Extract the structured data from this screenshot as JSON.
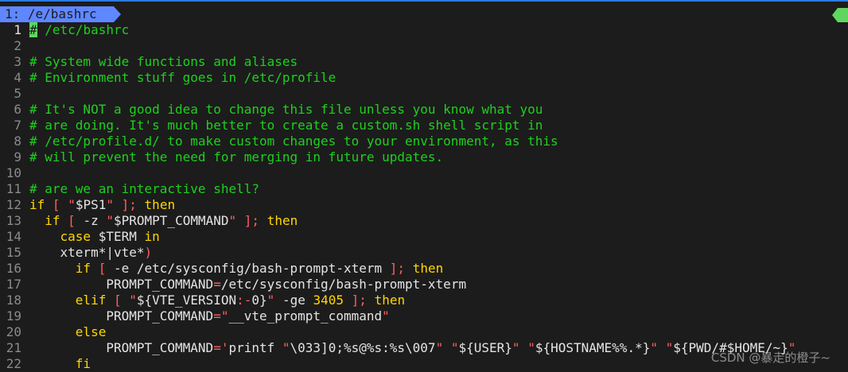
{
  "window": {
    "tab_label": "1: /e/bashrc"
  },
  "editor": {
    "lines": [
      {
        "n": "1",
        "t": "# /etc/bashrc"
      },
      {
        "n": "2",
        "t": ""
      },
      {
        "n": "3",
        "t": "# System wide functions and aliases"
      },
      {
        "n": "4",
        "t": "# Environment stuff goes in /etc/profile"
      },
      {
        "n": "5",
        "t": ""
      },
      {
        "n": "6",
        "t": "# It's NOT a good idea to change this file unless you know what you"
      },
      {
        "n": "7",
        "t": "# are doing. It's much better to create a custom.sh shell script in"
      },
      {
        "n": "8",
        "t": "# /etc/profile.d/ to make custom changes to your environment, as this"
      },
      {
        "n": "9",
        "t": "# will prevent the need for merging in future updates."
      },
      {
        "n": "10",
        "t": ""
      },
      {
        "n": "11",
        "t": "# are we an interactive shell?"
      },
      {
        "n": "12",
        "t": "if [ \"$PS1\" ]; then"
      },
      {
        "n": "13",
        "t": "  if [ -z \"$PROMPT_COMMAND\" ]; then"
      },
      {
        "n": "14",
        "t": "    case $TERM in"
      },
      {
        "n": "15",
        "t": "    xterm*|vte*)"
      },
      {
        "n": "16",
        "t": "      if [ -e /etc/sysconfig/bash-prompt-xterm ]; then"
      },
      {
        "n": "17",
        "t": "          PROMPT_COMMAND=/etc/sysconfig/bash-prompt-xterm"
      },
      {
        "n": "18",
        "t": "      elif [ \"${VTE_VERSION:-0}\" -ge 3405 ]; then"
      },
      {
        "n": "19",
        "t": "          PROMPT_COMMAND=\"__vte_prompt_command\""
      },
      {
        "n": "20",
        "t": "      else"
      },
      {
        "n": "21",
        "t": "          PROMPT_COMMAND='printf \"\\033]0;%s@%s:%s\\007\" \"${USER}\" \"${HOSTNAME%%.*}\" \"${PWD/#$HOME/~}\""
      },
      {
        "n": "22",
        "t": "      fi"
      }
    ]
  },
  "watermark": "CSDN @暴走的橙子~",
  "colors": {
    "background": "#1c1c1c",
    "comment": "#1ed01e",
    "keyword": "#ffd700",
    "string": "#ff5f5f",
    "tab_active": "#5f87ff",
    "cursor": "#5fd75f"
  }
}
